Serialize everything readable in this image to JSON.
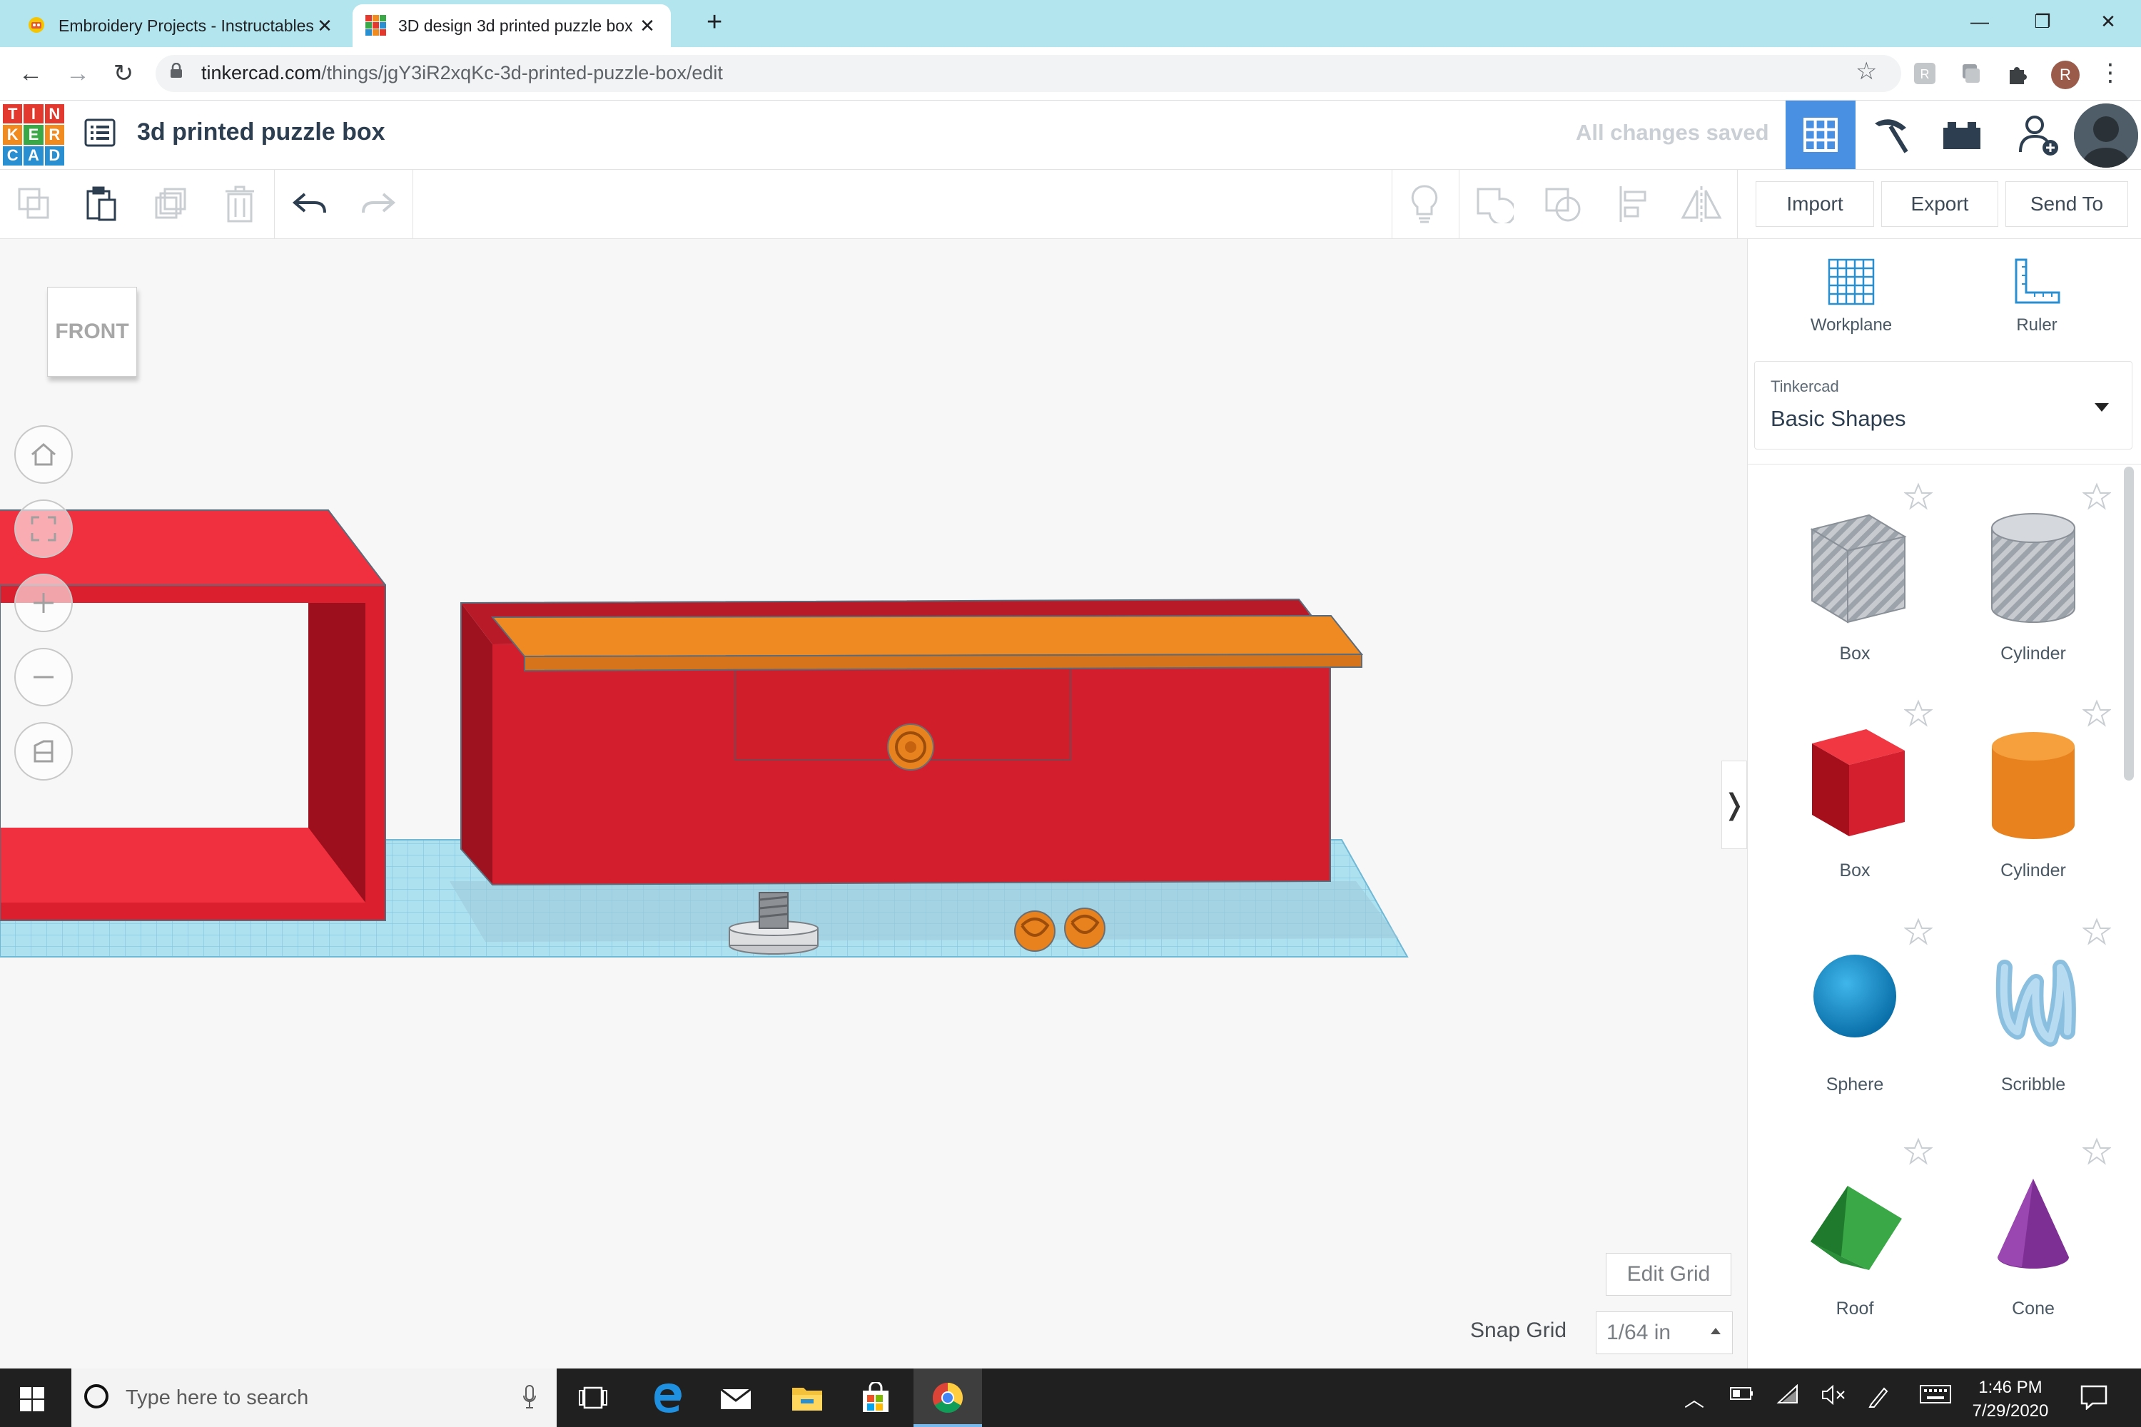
{
  "browser": {
    "tabs": [
      {
        "title": "Embroidery Projects - Instructables",
        "active": false
      },
      {
        "title": "3D design 3d printed puzzle box | Tinkercad",
        "active": true
      }
    ],
    "url_host": "tinkercad.com",
    "url_path": "/things/jgY3iR2xqKc-3d-printed-puzzle-box/edit",
    "profile_initial": "R"
  },
  "header": {
    "logo_letters": [
      "T",
      "I",
      "N",
      "K",
      "E",
      "R",
      "C",
      "A",
      "D"
    ],
    "design_title": "3d printed puzzle box",
    "status": "All changes saved"
  },
  "toolbar": {
    "import_label": "Import",
    "export_label": "Export",
    "send_to_label": "Send To"
  },
  "viewport": {
    "viewcube_face": "FRONT",
    "edit_grid_label": "Edit Grid",
    "snap_grid_label": "Snap Grid",
    "snap_grid_value": "1/64 in"
  },
  "panel": {
    "workplane_label": "Workplane",
    "ruler_label": "Ruler",
    "library_category": "Tinkercad",
    "library_name": "Basic Shapes",
    "shapes": [
      {
        "label": "Box",
        "icon": "box-striped-icon"
      },
      {
        "label": "Cylinder",
        "icon": "cylinder-striped-icon"
      },
      {
        "label": "Box",
        "icon": "box-red-icon"
      },
      {
        "label": "Cylinder",
        "icon": "cylinder-orange-icon"
      },
      {
        "label": "Sphere",
        "icon": "sphere-icon"
      },
      {
        "label": "Scribble",
        "icon": "scribble-icon"
      },
      {
        "label": "Roof",
        "icon": "roof-icon"
      },
      {
        "label": "Cone",
        "icon": "cone-icon"
      }
    ]
  },
  "taskbar": {
    "search_placeholder": "Type here to search",
    "time": "1:46 PM",
    "date": "7/29/2020"
  },
  "colors": {
    "accent": "#4a90e2",
    "part_red": "#d7202f",
    "part_orange": "#e8821e",
    "grid_blue": "#aee1f0"
  }
}
